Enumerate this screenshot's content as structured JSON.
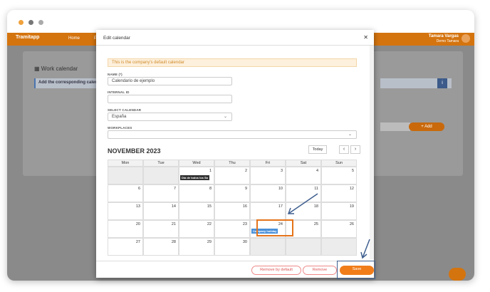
{
  "app": {
    "brand": "Tramitapp",
    "nav": [
      "Home",
      "Pe"
    ],
    "user_name": "Tamara Vargas",
    "user_company": "Demo Tamara"
  },
  "background": {
    "page_title": "Work calendar",
    "info_text": "Add the corresponding calen",
    "add_label": "Add"
  },
  "modal": {
    "title": "Edit calendar",
    "alert": "This is the company's default calendar",
    "name_label": "NAME (*)",
    "name_value": "Calendario de ejemplo",
    "internal_id_label": "INTERNAL ID",
    "internal_id_value": "",
    "select_calendar_label": "SELECT CALENDAR",
    "select_calendar_value": "España",
    "workplaces_label": "WORKPLACES",
    "workplaces_value": "",
    "month_title": "NOVEMBER 2023",
    "today_label": "Today",
    "weekdays": [
      "Mon",
      "Tue",
      "Wed",
      "Thu",
      "Fri",
      "Sat",
      "Sun"
    ],
    "weeks": [
      [
        "",
        "",
        "1",
        "2",
        "3",
        "4",
        "5"
      ],
      [
        "6",
        "7",
        "8",
        "9",
        "10",
        "11",
        "12"
      ],
      [
        "13",
        "14",
        "15",
        "16",
        "17",
        "18",
        "19"
      ],
      [
        "20",
        "21",
        "22",
        "23",
        "24",
        "25",
        "26"
      ],
      [
        "27",
        "28",
        "29",
        "30",
        "",
        "",
        ""
      ]
    ],
    "events": {
      "wed1": "Día de todos los Sa",
      "fri24": "Company holiday"
    },
    "buttons": {
      "remove_default": "Remove by default",
      "remove": "Remove",
      "save": "Save"
    }
  },
  "colors": {
    "brand": "#d4740f",
    "event_dark": "#333333",
    "event_blue": "#4a90d9",
    "highlight": "#e4741a"
  }
}
